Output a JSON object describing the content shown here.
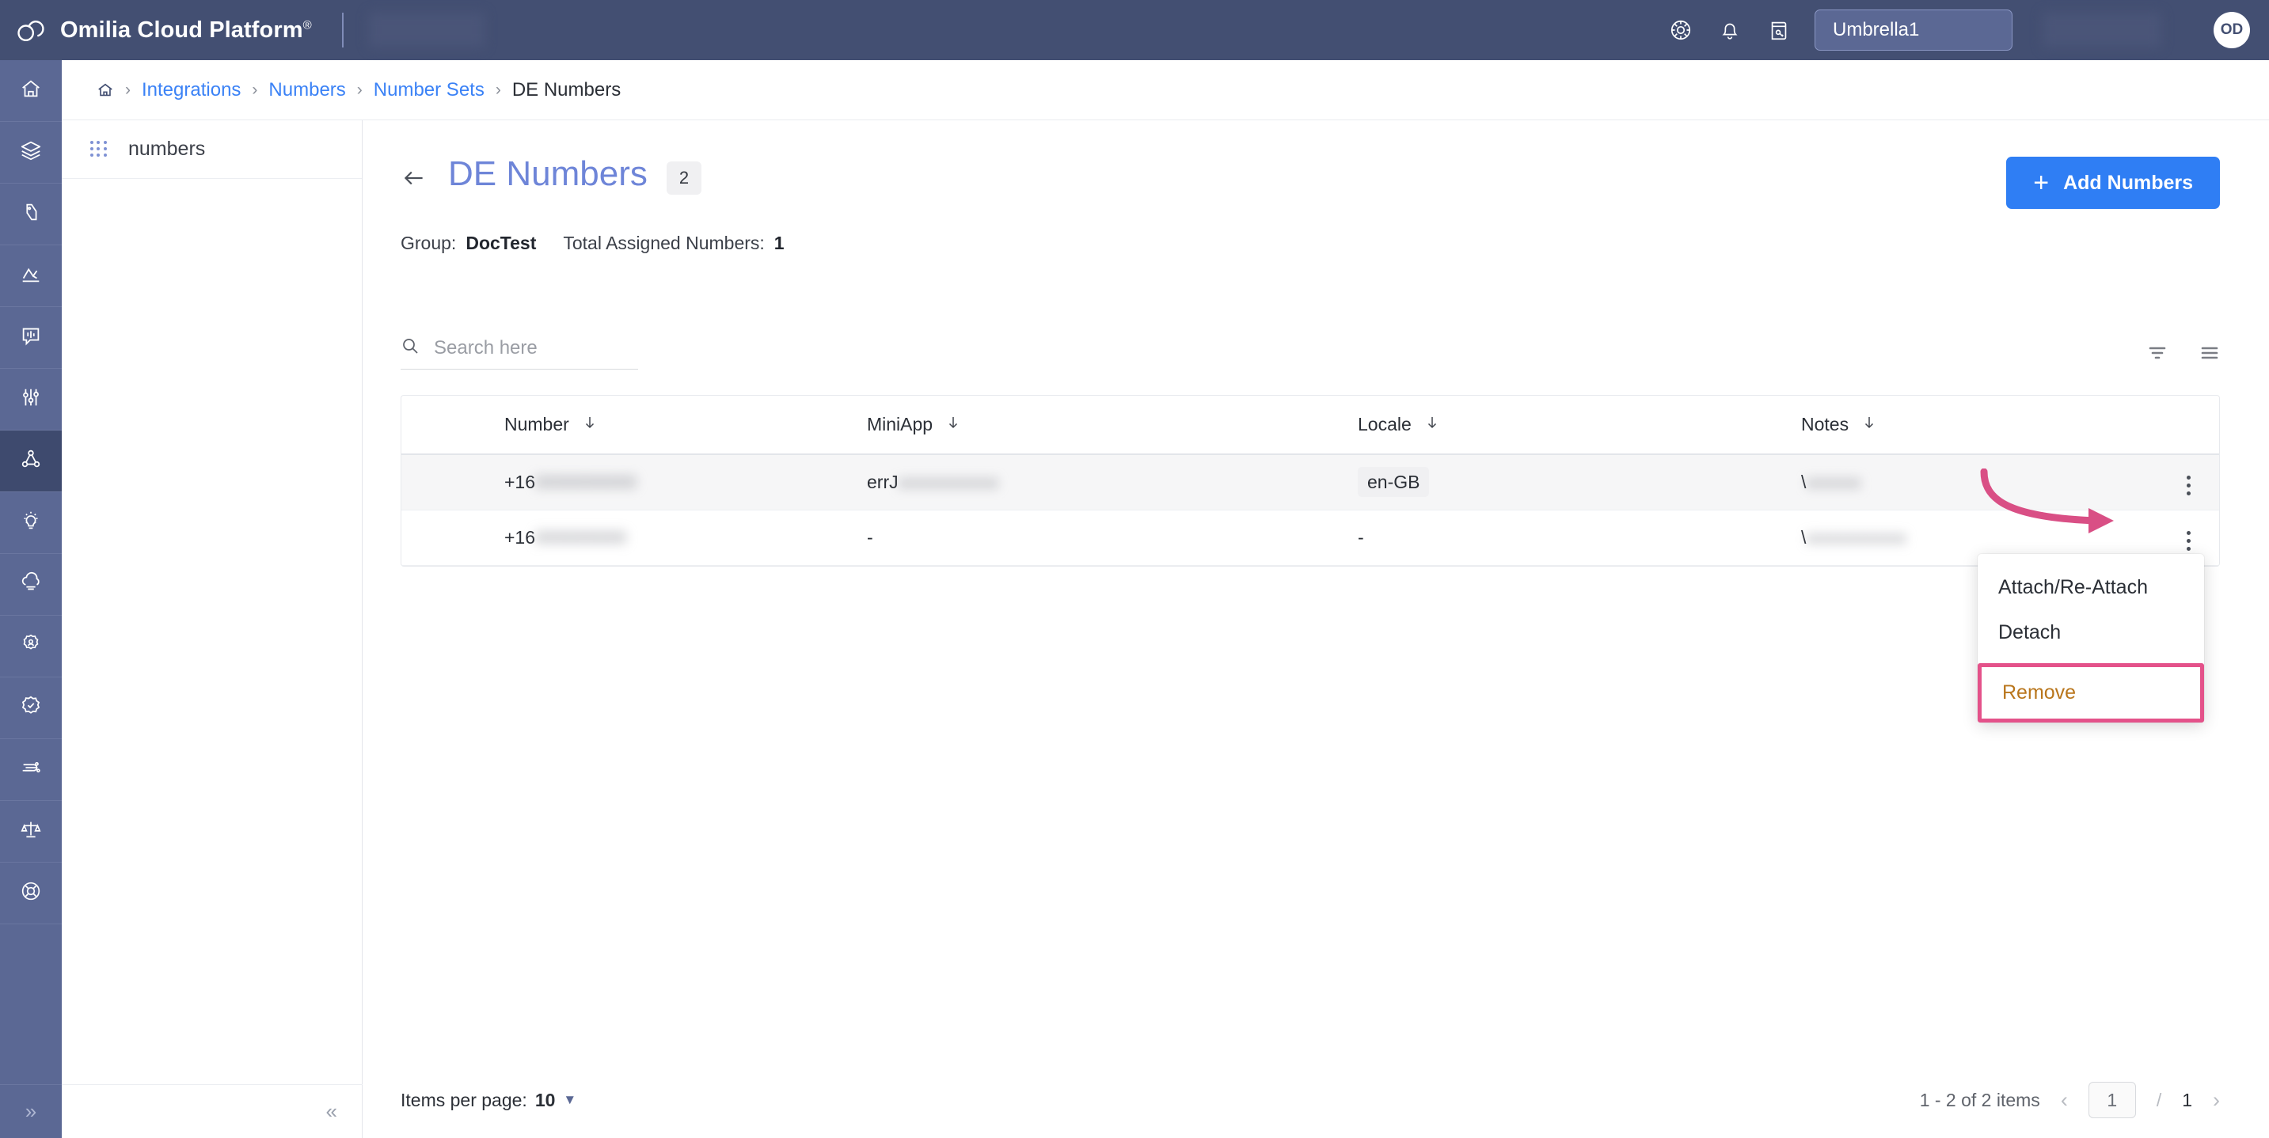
{
  "header": {
    "brand": "Omilia Cloud Platform",
    "brand_mark": "®",
    "umbrella_label": "Umbrella1",
    "avatar_initials": "OD",
    "icons": [
      "globe-settings-icon",
      "bell-icon",
      "notes-key-icon"
    ]
  },
  "rail": {
    "items": [
      {
        "name": "home-icon",
        "active": false
      },
      {
        "name": "layers-icon",
        "active": false
      },
      {
        "name": "voice-biometrics-icon",
        "active": false
      },
      {
        "name": "analytics-icon",
        "active": false
      },
      {
        "name": "conversation-icon",
        "active": false
      },
      {
        "name": "tuning-sliders-icon",
        "active": false
      },
      {
        "name": "integrations-icon",
        "active": true
      },
      {
        "name": "insights-bulb-icon",
        "active": false
      },
      {
        "name": "cloud-icon",
        "active": false
      },
      {
        "name": "user-settings-icon",
        "active": false
      },
      {
        "name": "verified-badge-icon",
        "active": false
      },
      {
        "name": "deployment-icon",
        "active": false
      },
      {
        "name": "compliance-scales-icon",
        "active": false
      },
      {
        "name": "support-lifebuoy-icon",
        "active": false
      }
    ],
    "collapse_glyph": "»"
  },
  "subnav": {
    "items": [
      {
        "label": "numbers"
      }
    ],
    "collapse_glyph": "«"
  },
  "breadcrumb": {
    "home": "home-icon",
    "separator": "›",
    "items": [
      {
        "label": "Integrations",
        "link": true
      },
      {
        "label": "Numbers",
        "link": true
      },
      {
        "label": "Number Sets",
        "link": true
      },
      {
        "label": "DE Numbers",
        "link": false
      }
    ]
  },
  "page": {
    "title": "DE Numbers",
    "count_badge": "2",
    "add_button": "Add Numbers",
    "add_button_icon": "plus-icon",
    "back_icon": "arrow-left-icon",
    "meta": {
      "group_label": "Group:",
      "group_value": "DocTest",
      "assigned_label": "Total Assigned Numbers:",
      "assigned_value": "1"
    }
  },
  "search": {
    "placeholder": "Search here",
    "value": "",
    "icon": "search-icon"
  },
  "tools": [
    {
      "name": "filter-icon"
    },
    {
      "name": "list-view-icon"
    }
  ],
  "table": {
    "columns": [
      {
        "label": "Number",
        "sort_icon": "sort-arrow-down-icon"
      },
      {
        "label": "MiniApp",
        "sort_icon": "sort-arrow-down-icon"
      },
      {
        "label": "Locale",
        "sort_icon": "sort-arrow-down-icon"
      },
      {
        "label": "Notes",
        "sort_icon": "sort-arrow-down-icon"
      }
    ],
    "rows": [
      {
        "number": "+16",
        "number_redacted": "0000000000",
        "miniapp": "errJ",
        "miniapp_redacted": "xxxxxxxxxxx",
        "locale": "en-GB",
        "notes": "\\",
        "notes_redacted": "xxxxxx",
        "hovered": true
      },
      {
        "number": "+16",
        "number_redacted": "000000000",
        "miniapp": "-",
        "miniapp_redacted": "",
        "locale": "-",
        "notes": "\\",
        "notes_redacted": "xxxxxxxxxxx",
        "hovered": false
      }
    ],
    "row_menu_icon": "kebab-menu-icon"
  },
  "context_menu": {
    "items": [
      {
        "label": "Attach/Re-Attach",
        "highlighted": false
      },
      {
        "label": "Detach",
        "highlighted": false
      },
      {
        "label": "Remove",
        "highlighted": true
      }
    ],
    "highlight_color": "#e4528a",
    "danger_color": "#b9761c"
  },
  "footer": {
    "items_per_page_label": "Items per page:",
    "items_per_page_value": "10",
    "caret": "▼",
    "range_text": "1 - 2 of 2 items",
    "prev_glyph": "‹",
    "next_glyph": "›",
    "current_page": "1",
    "page_separator": "/",
    "total_pages": "1"
  },
  "colors": {
    "header_bg": "#434f72",
    "rail_bg": "#5b6894",
    "accent_blue": "#2f7ef4",
    "title_blue": "#6e85d8",
    "link_blue": "#3b82f6",
    "annotation_pink": "#e4528a"
  }
}
